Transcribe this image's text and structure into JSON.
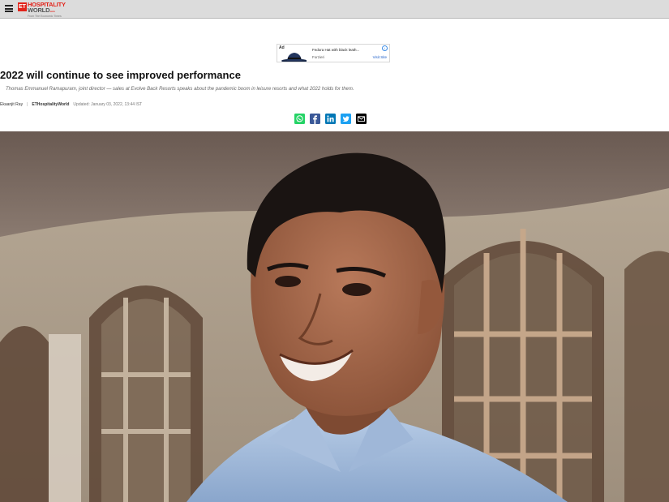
{
  "header": {
    "menu_icon": "hamburger-menu-icon",
    "logo": {
      "badge": "ET",
      "name_primary": "HOSPITALITY",
      "name_secondary": "WORLD",
      "suffix": ".com",
      "tagline": "From The Economic Times"
    }
  },
  "ad": {
    "badge": "Ad",
    "title": "Fedora Hat with black leath...",
    "source": "Forzieri",
    "cta": "Visit Site",
    "info_icon": "adchoices-info-icon"
  },
  "article": {
    "title": "2022 will continue to see improved performance",
    "summary": "Thomas Emmanuel Ramapuram, joint director — sales at Evolve Back Resorts speaks about the pandemic boom in leisure resorts and what 2022 holds for them.",
    "author": "Ekaanjit Ray",
    "publication": "ETHospitalityWorld",
    "updated": "Updated: January 03, 2022, 13:44 IST"
  },
  "share": [
    {
      "name": "whatsapp-icon",
      "color": "#25d366"
    },
    {
      "name": "facebook-icon",
      "color": "#3b5998"
    },
    {
      "name": "linkedin-icon",
      "color": "#0077b5"
    },
    {
      "name": "twitter-icon",
      "color": "#1da1f2"
    },
    {
      "name": "email-icon",
      "color": "#000000"
    }
  ],
  "hero_image": {
    "description_icon": "hero-portrait-image"
  }
}
